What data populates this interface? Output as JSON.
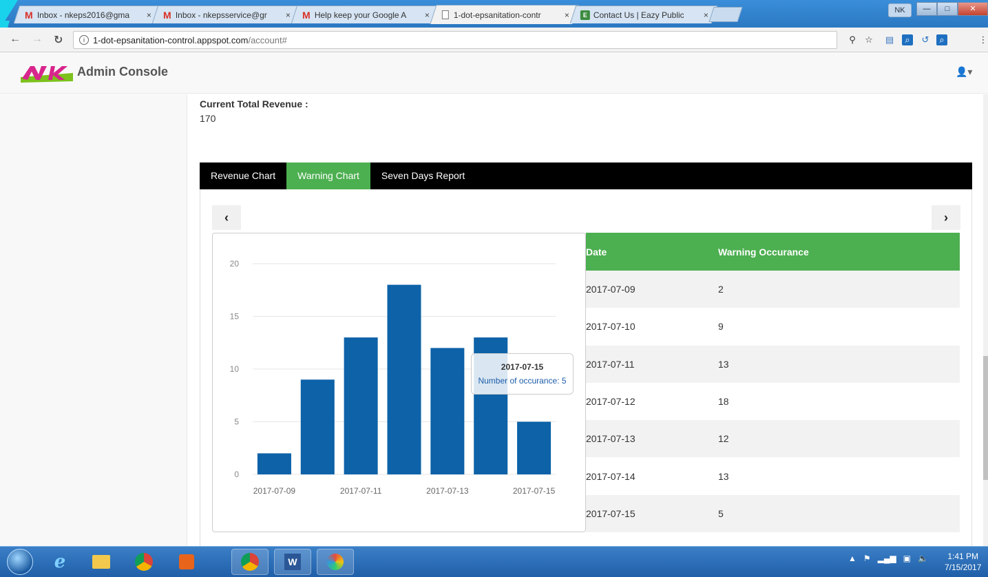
{
  "browser": {
    "tabs": [
      {
        "title": "Inbox - nkeps2016@gma",
        "icon": "gmail-icon"
      },
      {
        "title": "Inbox - nkepsservice@gr",
        "icon": "gmail-icon"
      },
      {
        "title": "Help keep your Google A",
        "icon": "gmail-icon"
      },
      {
        "title": "1-dot-epsanitation-contr",
        "icon": "page-icon"
      },
      {
        "title": "Contact Us | Eazy Public",
        "icon": "eazy-icon"
      }
    ],
    "close_glyph": "×",
    "user_badge": "NK",
    "url_host": "1-dot-epsanitation-control.appspot.com",
    "url_path": "/account#"
  },
  "header": {
    "brand": "Admin Console",
    "user_menu": "👤▾"
  },
  "revenue": {
    "label": "Current Total Revenue :",
    "value": "170"
  },
  "tabs": [
    {
      "label": "Revenue Chart",
      "active": false
    },
    {
      "label": "Warning Chart",
      "active": true
    },
    {
      "label": "Seven Days Report",
      "active": false
    }
  ],
  "nav": {
    "prev": "‹",
    "next": "›"
  },
  "tooltip": {
    "date": "2017-07-15",
    "text": "Number of occurance: 5"
  },
  "table": {
    "headers": [
      "Date",
      "Warning Occurance"
    ],
    "rows": [
      [
        "2017-07-09",
        "2"
      ],
      [
        "2017-07-10",
        "9"
      ],
      [
        "2017-07-11",
        "13"
      ],
      [
        "2017-07-12",
        "18"
      ],
      [
        "2017-07-13",
        "12"
      ],
      [
        "2017-07-14",
        "13"
      ],
      [
        "2017-07-15",
        "5"
      ]
    ]
  },
  "chart_data": {
    "type": "bar",
    "categories": [
      "2017-07-09",
      "2017-07-10",
      "2017-07-11",
      "2017-07-12",
      "2017-07-13",
      "2017-07-14",
      "2017-07-15"
    ],
    "values": [
      2,
      9,
      13,
      18,
      12,
      13,
      5
    ],
    "x_tick_labels": [
      "2017-07-09",
      "2017-07-11",
      "2017-07-13",
      "2017-07-15"
    ],
    "y_ticks": [
      0,
      5,
      10,
      15,
      20
    ],
    "ylim": [
      0,
      20
    ],
    "grid": true,
    "bar_color": "#0d62a8"
  },
  "taskbar": {
    "time": "1:41 PM",
    "date": "7/15/2017"
  },
  "colors": {
    "accent": "#4caf50",
    "tab_bar": "#000000",
    "bar": "#0d62a8"
  }
}
